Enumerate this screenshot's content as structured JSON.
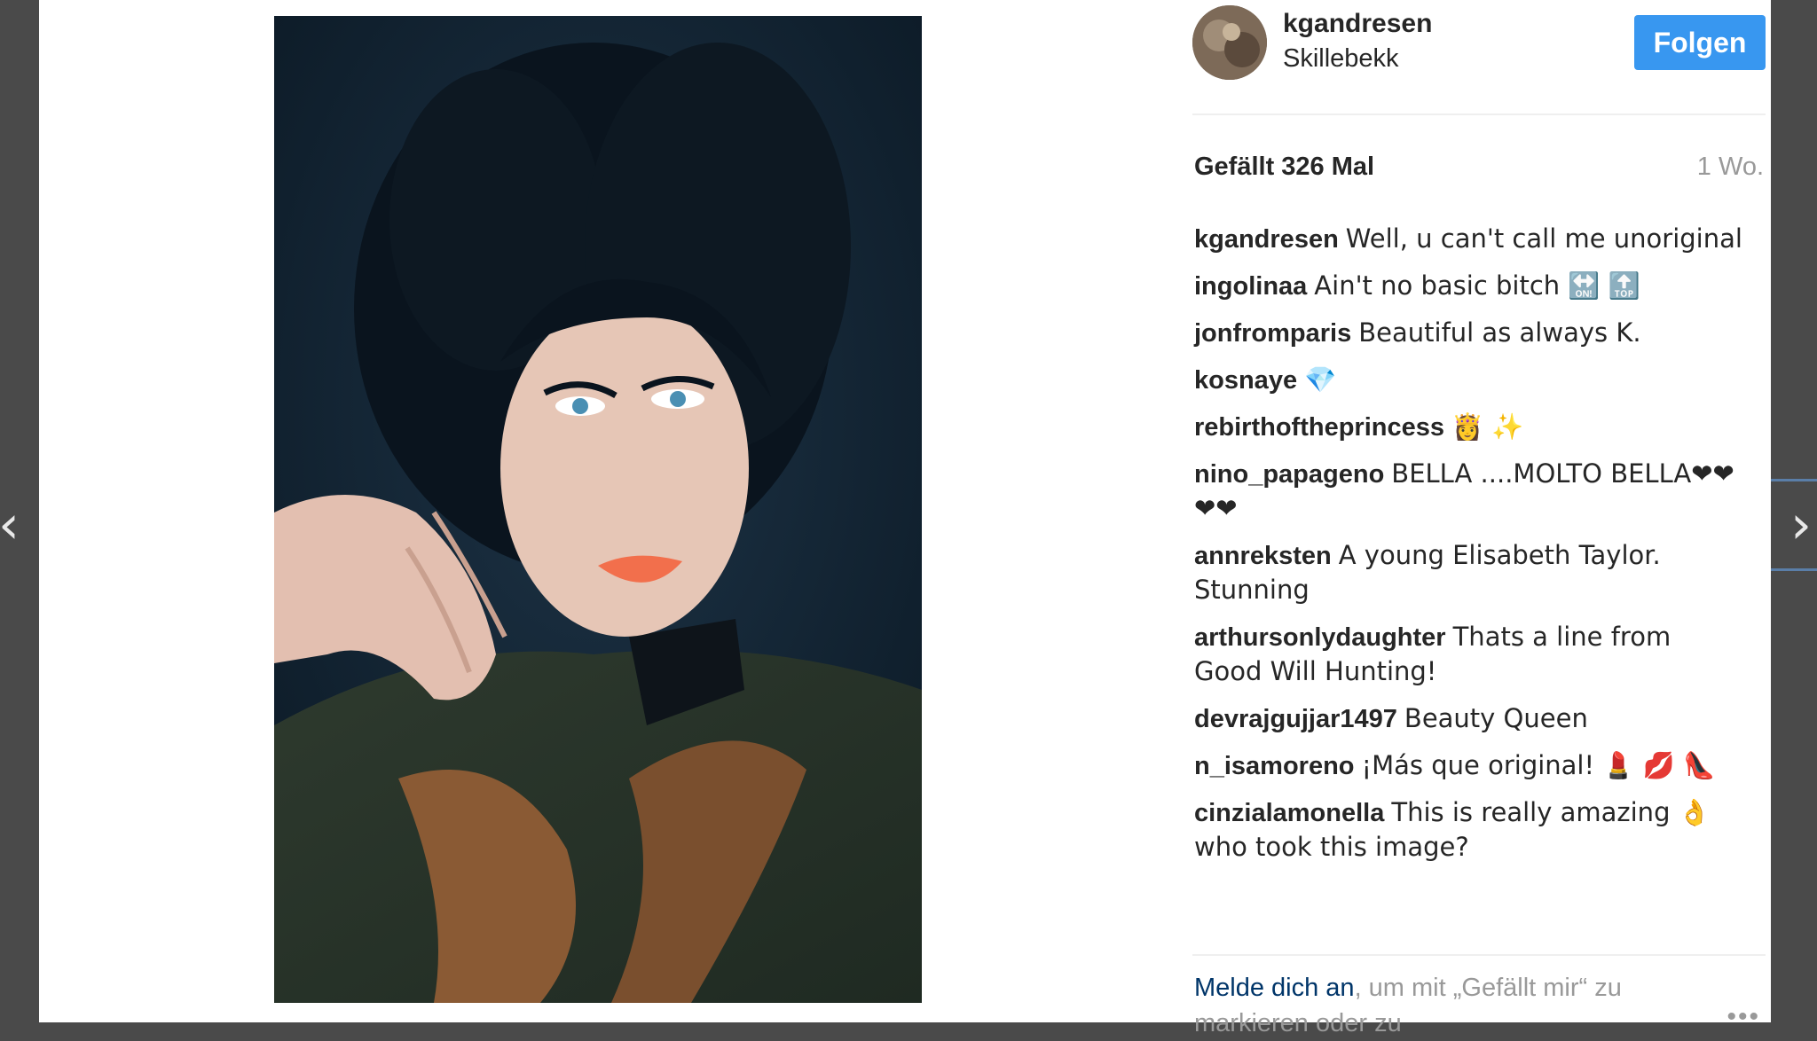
{
  "navigation": {
    "prev_icon": "chevron-left-icon",
    "next_icon": "chevron-right-icon",
    "prev_glyph": "‹",
    "next_glyph": "›"
  },
  "post": {
    "username": "kgandresen",
    "location": "Skillebekk",
    "follow_label": "Folgen",
    "likes_text": "Gefällt 326 Mal",
    "time_ago": "1 Wo."
  },
  "comments": [
    {
      "user": "kgandresen",
      "text": "Well, u can't call me unoriginal"
    },
    {
      "user": "ingolinaa",
      "text": "Ain't no basic bitch 🔛 🔝"
    },
    {
      "user": "jonfromparis",
      "text": "Beautiful as always K."
    },
    {
      "user": "kosnaye",
      "text": "💎"
    },
    {
      "user": "rebirthoftheprincess",
      "text": "👸 ✨"
    },
    {
      "user": "nino_papageno",
      "text": "BELLA ....MOLTO BELLA❤❤❤❤"
    },
    {
      "user": "annreksten",
      "text": "A young Elisabeth Taylor. Stunning"
    },
    {
      "user": "arthursonlydaughter",
      "text": "Thats a line from Good Will Hunting!"
    },
    {
      "user": "devrajgujjar1497",
      "text": "Beauty Queen"
    },
    {
      "user": "n_isamoreno",
      "text": "¡Más que original! 💄 💋 👠"
    },
    {
      "user": "cinzialamonella",
      "text": "This is really amazing 👌 who took this image?"
    }
  ],
  "footer": {
    "login_link": "Melde dich an",
    "login_rest": ", um mit „Gefällt mir“ zu markieren oder zu",
    "more_label": "•••"
  },
  "colors": {
    "follow_bg": "#3897f0",
    "link": "#003569",
    "muted": "#999999"
  }
}
